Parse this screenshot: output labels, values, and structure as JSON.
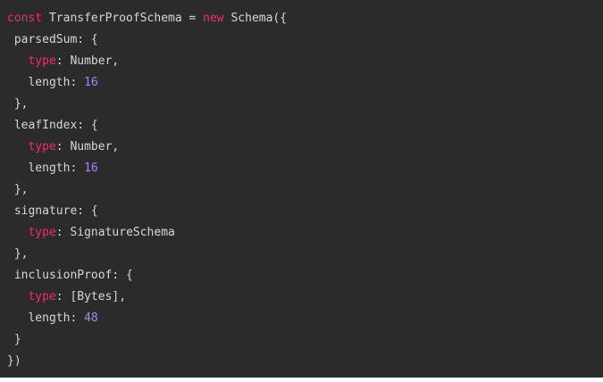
{
  "code": {
    "lines": [
      [
        {
          "t": "const",
          "c": "kw"
        },
        {
          "t": " TransferProofSchema = ",
          "c": "text"
        },
        {
          "t": "new",
          "c": "kw"
        },
        {
          "t": " Schema({",
          "c": "text"
        }
      ],
      [
        {
          "t": " parsedSum: {",
          "c": "prop"
        }
      ],
      [
        {
          "t": "   ",
          "c": "text"
        },
        {
          "t": "type",
          "c": "type"
        },
        {
          "t": ": Number,",
          "c": "text"
        }
      ],
      [
        {
          "t": "   length: ",
          "c": "text"
        },
        {
          "t": "16",
          "c": "num"
        }
      ],
      [
        {
          "t": " },",
          "c": "text"
        }
      ],
      [
        {
          "t": " leafIndex: {",
          "c": "prop"
        }
      ],
      [
        {
          "t": "   ",
          "c": "text"
        },
        {
          "t": "type",
          "c": "type"
        },
        {
          "t": ": Number,",
          "c": "text"
        }
      ],
      [
        {
          "t": "   length: ",
          "c": "text"
        },
        {
          "t": "16",
          "c": "num"
        }
      ],
      [
        {
          "t": " },",
          "c": "text"
        }
      ],
      [
        {
          "t": " signature: {",
          "c": "prop"
        }
      ],
      [
        {
          "t": "   ",
          "c": "text"
        },
        {
          "t": "type",
          "c": "type"
        },
        {
          "t": ": SignatureSchema",
          "c": "text"
        }
      ],
      [
        {
          "t": " },",
          "c": "text"
        }
      ],
      [
        {
          "t": " inclusionProof: {",
          "c": "prop"
        }
      ],
      [
        {
          "t": "   ",
          "c": "text"
        },
        {
          "t": "type",
          "c": "type"
        },
        {
          "t": ": [Bytes],",
          "c": "text"
        }
      ],
      [
        {
          "t": "   length: ",
          "c": "text"
        },
        {
          "t": "48",
          "c": "num"
        }
      ],
      [
        {
          "t": " }",
          "c": "text"
        }
      ],
      [
        {
          "t": "})",
          "c": "text"
        }
      ]
    ]
  },
  "colors": {
    "background": "#2b2b2b",
    "keyword": "#f92672",
    "number": "#ae81ff",
    "text": "#d7d7d7"
  }
}
